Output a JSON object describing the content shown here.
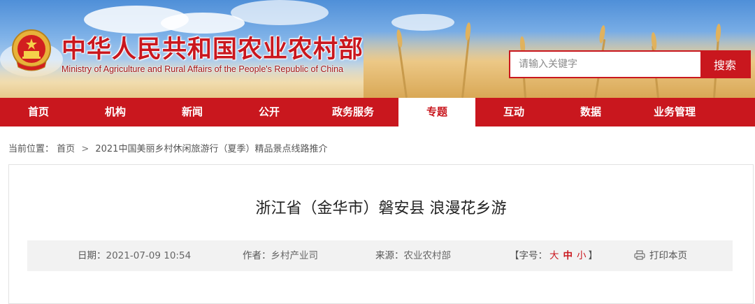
{
  "header": {
    "title": "中华人民共和国农业农村部",
    "subtitle": "Ministry of Agriculture and Rural Affairs of the People's Republic of China",
    "emblem_icon": "national-emblem-icon"
  },
  "search": {
    "placeholder": "请输入关键字",
    "button_label": "搜索"
  },
  "nav": {
    "items": [
      {
        "label": "首页"
      },
      {
        "label": "机构"
      },
      {
        "label": "新闻"
      },
      {
        "label": "公开"
      },
      {
        "label": "政务服务"
      },
      {
        "label": "专题",
        "active": true
      },
      {
        "label": "互动"
      },
      {
        "label": "数据"
      },
      {
        "label": "业务管理"
      }
    ]
  },
  "breadcrumb": {
    "prefix": "当前位置：",
    "home": "首页",
    "separator": ">",
    "current": "2021中国美丽乡村休闲旅游行（夏季）精品景点线路推介"
  },
  "article": {
    "title": "浙江省（金华市）磐安县 浪漫花乡游",
    "date_label": "日期：",
    "date_value": "2021-07-09 10:54",
    "author_label": "作者：",
    "author_value": "乡村产业司",
    "source_label": "来源：",
    "source_value": "农业农村部",
    "font_size_label": "【字号：",
    "font_size_large": "大",
    "font_size_medium": "中",
    "font_size_small": "小",
    "font_size_close": "】",
    "print_label": "打印本页",
    "print_icon": "printer-icon"
  },
  "colors": {
    "brand_red": "#c9171e",
    "meta_bg": "#f2f2f2"
  }
}
